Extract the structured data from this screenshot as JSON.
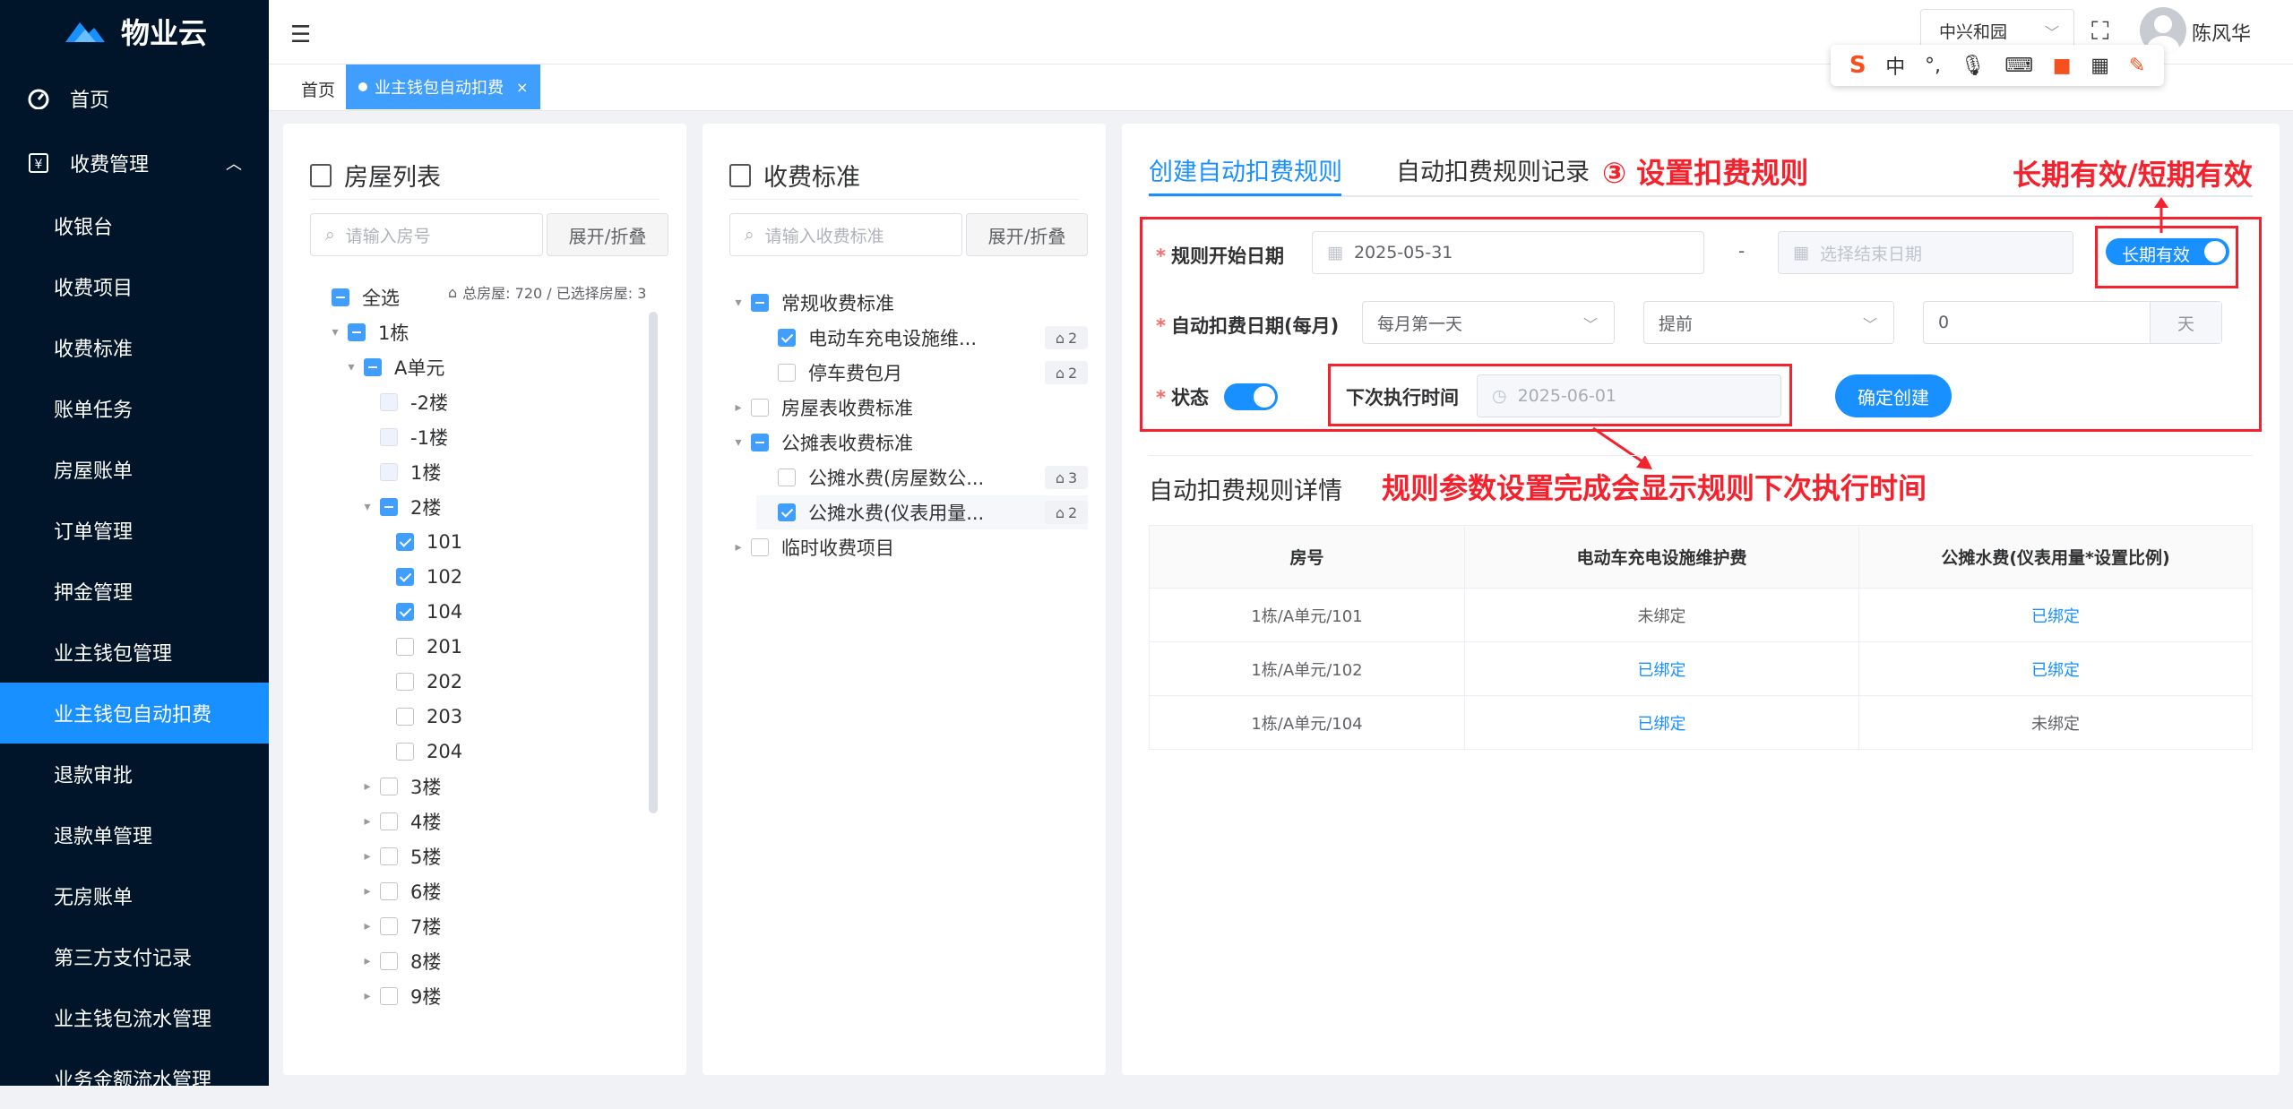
{
  "app": {
    "logo_text": "物业云"
  },
  "sidebar": {
    "home": "首页",
    "group": "收费管理",
    "items": [
      "收银台",
      "收费项目",
      "收费标准",
      "账单任务",
      "房屋账单",
      "订单管理",
      "押金管理",
      "业主钱包管理",
      "业主钱包自动扣费",
      "退款审批",
      "退款单管理",
      "无房账单",
      "第三方支付记录",
      "业主钱包流水管理",
      "业务金额流水管理"
    ],
    "active_index": 8
  },
  "header": {
    "community": "中兴和园",
    "user": "陈风华"
  },
  "ime": {
    "items": [
      "中",
      "°,",
      "mic",
      "keyboard",
      "gift",
      "grid",
      "skin"
    ]
  },
  "tabs": {
    "home": "首页",
    "active": "业主钱包自动扣费"
  },
  "house_panel": {
    "title": "房屋列表",
    "search_placeholder": "请输入房号",
    "expand_button": "展开/折叠",
    "summary": "总房屋: 720 / 已选择房屋: 3",
    "tree": [
      {
        "label": "全选",
        "level": 0,
        "state": "ind",
        "caret": ""
      },
      {
        "label": "1栋",
        "level": 1,
        "state": "ind",
        "caret": "open"
      },
      {
        "label": "A单元",
        "level": 2,
        "state": "ind",
        "caret": "open"
      },
      {
        "label": "-2楼",
        "level": 3,
        "state": "disabled",
        "caret": ""
      },
      {
        "label": "-1楼",
        "level": 3,
        "state": "disabled",
        "caret": ""
      },
      {
        "label": "1楼",
        "level": 3,
        "state": "disabled",
        "caret": ""
      },
      {
        "label": "2楼",
        "level": 3,
        "state": "ind",
        "caret": "open"
      },
      {
        "label": "101",
        "level": 4,
        "state": "checked",
        "caret": ""
      },
      {
        "label": "102",
        "level": 4,
        "state": "checked",
        "caret": ""
      },
      {
        "label": "104",
        "level": 4,
        "state": "checked",
        "caret": ""
      },
      {
        "label": "201",
        "level": 4,
        "state": "",
        "caret": ""
      },
      {
        "label": "202",
        "level": 4,
        "state": "",
        "caret": ""
      },
      {
        "label": "203",
        "level": 4,
        "state": "",
        "caret": ""
      },
      {
        "label": "204",
        "level": 4,
        "state": "",
        "caret": ""
      },
      {
        "label": "3楼",
        "level": 3,
        "state": "",
        "caret": "closed"
      },
      {
        "label": "4楼",
        "level": 3,
        "state": "",
        "caret": "closed"
      },
      {
        "label": "5楼",
        "level": 3,
        "state": "",
        "caret": "closed"
      },
      {
        "label": "6楼",
        "level": 3,
        "state": "",
        "caret": "closed"
      },
      {
        "label": "7楼",
        "level": 3,
        "state": "",
        "caret": "closed"
      },
      {
        "label": "8楼",
        "level": 3,
        "state": "",
        "caret": "closed"
      },
      {
        "label": "9楼",
        "level": 3,
        "state": "",
        "caret": "closed"
      }
    ]
  },
  "fee_panel": {
    "title": "收费标准",
    "search_placeholder": "请输入收费标准",
    "expand_button": "展开/折叠",
    "tree": [
      {
        "label": "常规收费标准",
        "level": 0,
        "state": "ind",
        "caret": "open",
        "badge": ""
      },
      {
        "label": "电动车充电设施维...",
        "level": 1,
        "state": "checked",
        "caret": "",
        "badge": "2"
      },
      {
        "label": "停车费包月",
        "level": 1,
        "state": "",
        "caret": "",
        "badge": "2"
      },
      {
        "label": "房屋表收费标准",
        "level": 0,
        "state": "",
        "caret": "closed",
        "badge": ""
      },
      {
        "label": "公摊表收费标准",
        "level": 0,
        "state": "ind",
        "caret": "open",
        "badge": ""
      },
      {
        "label": "公摊水费(房屋数公...",
        "level": 1,
        "state": "",
        "caret": "",
        "badge": "3"
      },
      {
        "label": "公摊水费(仪表用量...",
        "level": 1,
        "state": "checked",
        "caret": "",
        "badge": "2"
      },
      {
        "label": "临时收费项目",
        "level": 0,
        "state": "",
        "caret": "closed",
        "badge": ""
      }
    ]
  },
  "rule_panel": {
    "tab_create": "创建自动扣费规则",
    "tab_records": "自动扣费规则记录",
    "annotation_step": "③ 设置扣费规则",
    "annotation_validity": "长期有效/短期有效",
    "annotation_next": "规则参数设置完成会显示规则下次执行时间",
    "start_label": "规则开始日期",
    "start_value": "2025-05-31",
    "range_sep": "-",
    "end_placeholder": "选择结束日期",
    "long_term_label": "长期有效",
    "auto_date_label": "自动扣费日期(每月)",
    "day_select": "每月第一天",
    "advance_select": "提前",
    "advance_value": "0",
    "advance_unit": "天",
    "status_label": "状态",
    "next_label": "下次执行时间",
    "next_value": "2025-06-01",
    "confirm_button": "确定创建",
    "details_title": "自动扣费规则详情",
    "table": {
      "headers": [
        "房号",
        "电动车充电设施维护费",
        "公摊水费(仪表用量*设置比例)"
      ],
      "rows": [
        [
          "1栋/A单元/101",
          "未绑定",
          "已绑定"
        ],
        [
          "1栋/A单元/102",
          "已绑定",
          "已绑定"
        ],
        [
          "1栋/A单元/104",
          "已绑定",
          "未绑定"
        ]
      ]
    }
  },
  "colors": {
    "sidebar_bg": "#001529",
    "primary": "#1890ff",
    "annotation": "#f5222d"
  }
}
